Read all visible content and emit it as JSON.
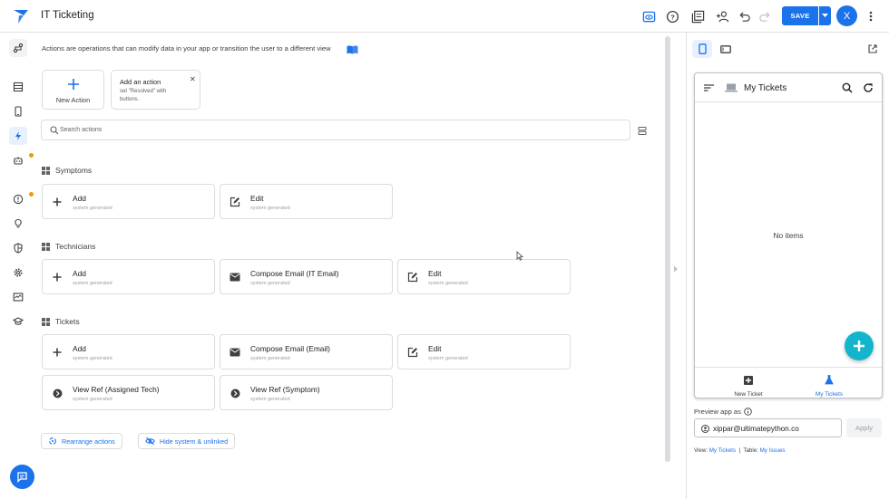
{
  "app": {
    "title": "IT Ticketing"
  },
  "header": {
    "save_label": "SAVE",
    "avatar_letter": "X",
    "icons": [
      "preview-eye-icon",
      "help-icon",
      "library-icon",
      "add-person-icon",
      "undo-icon",
      "redo-icon"
    ]
  },
  "colors": {
    "accent": "#1a73e8",
    "fab": "#12b5cb",
    "warning_dot": "#f29900"
  },
  "rail": {
    "items": [
      "pipeline-icon",
      "data-icon",
      "app-icon",
      "actions-icon",
      "automation-icon",
      "info-icon",
      "idea-icon",
      "security-icon",
      "settings-icon",
      "monitor-icon",
      "learn-icon"
    ],
    "active": "actions-icon"
  },
  "main": {
    "info_text": "Actions are operations that can modify data in your app or transition the user to a different view",
    "new_action_label": "New Action",
    "tip": {
      "title": "Add an action",
      "body": "set \"Resolved\" with buttons."
    },
    "search_placeholder": "Search actions",
    "sections": [
      {
        "name": "Symptoms",
        "actions": [
          {
            "title": "Add",
            "subtitle": "system generated",
            "icon": "plus-icon"
          },
          {
            "title": "Edit",
            "subtitle": "system generated",
            "icon": "edit-icon"
          }
        ]
      },
      {
        "name": "Technicians",
        "actions": [
          {
            "title": "Add",
            "subtitle": "system generated",
            "icon": "plus-icon"
          },
          {
            "title": "Compose Email (IT Email)",
            "subtitle": "system generated",
            "icon": "email-icon"
          },
          {
            "title": "Edit",
            "subtitle": "system generated",
            "icon": "edit-icon"
          }
        ]
      },
      {
        "name": "Tickets",
        "actions": [
          {
            "title": "Add",
            "subtitle": "system generated",
            "icon": "plus-icon"
          },
          {
            "title": "Compose Email (Email)",
            "subtitle": "system generated",
            "icon": "email-icon"
          },
          {
            "title": "Edit",
            "subtitle": "system generated",
            "icon": "edit-icon"
          },
          {
            "title": "View Ref (Assigned Tech)",
            "subtitle": "system generated",
            "icon": "view-ref-icon"
          },
          {
            "title": "View Ref (Symptom)",
            "subtitle": "system generated",
            "icon": "view-ref-icon"
          }
        ]
      }
    ],
    "rearrange_label": "Rearrange actions",
    "hide_label": "Hide system & unlinked"
  },
  "preview": {
    "screen_title": "My Tickets",
    "empty_text": "No items",
    "tabs": [
      {
        "label": "New Ticket",
        "icon": "add-box-icon",
        "active": false
      },
      {
        "label": "My Tickets",
        "icon": "flask-icon",
        "active": true
      }
    ],
    "preview_as_label": "Preview app as",
    "email_value": "xippar@ultimatepython.co",
    "apply_label": "Apply",
    "view_prefix": "View:",
    "view_value": "My Tickets",
    "separator": "|",
    "table_prefix": "Table:",
    "table_value": "My Issues"
  }
}
